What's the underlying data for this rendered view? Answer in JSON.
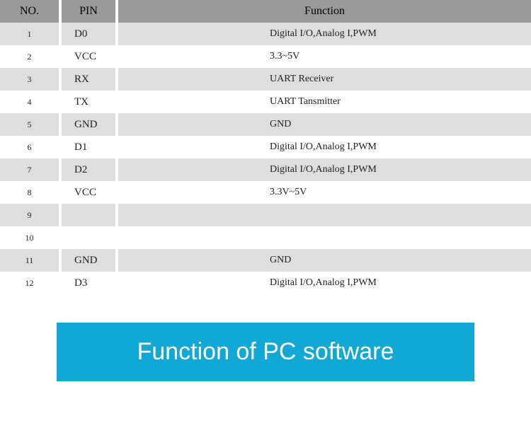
{
  "chart_data": {
    "type": "table",
    "columns": [
      "NO.",
      "PIN",
      "Function"
    ],
    "rows": [
      {
        "no": "1",
        "pin": "D0",
        "func": "Digital I/O,Analog I,PWM"
      },
      {
        "no": "2",
        "pin": "VCC",
        "func": "3.3~5V"
      },
      {
        "no": "3",
        "pin": "RX",
        "func": "UART Receiver"
      },
      {
        "no": "4",
        "pin": "TX",
        "func": "UART Tansmitter"
      },
      {
        "no": "5",
        "pin": "GND",
        "func": "GND"
      },
      {
        "no": "6",
        "pin": "D1",
        "func": "Digital I/O,Analog I,PWM"
      },
      {
        "no": "7",
        "pin": "D2",
        "func": "Digital I/O,Analog I,PWM"
      },
      {
        "no": "8",
        "pin": "VCC",
        "func": "3.3V~5V"
      },
      {
        "no": "9",
        "pin": "",
        "func": ""
      },
      {
        "no": "10",
        "pin": "",
        "func": ""
      },
      {
        "no": "11",
        "pin": "GND",
        "func": "GND"
      },
      {
        "no": "12",
        "pin": "D3",
        "func": "Digital I/O,Analog I,PWM"
      }
    ]
  },
  "banner": {
    "title": "Function of PC software"
  }
}
